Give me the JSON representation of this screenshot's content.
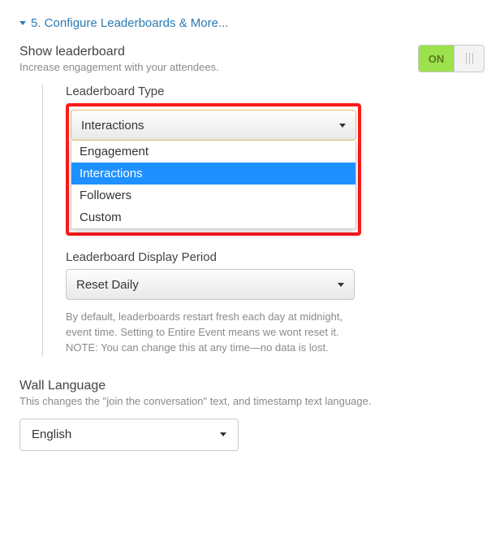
{
  "section": {
    "title": "5. Configure Leaderboards & More..."
  },
  "showLeaderboard": {
    "title": "Show leaderboard",
    "subtitle": "Increase engagement with your attendees.",
    "toggleOn": "ON"
  },
  "leaderboardType": {
    "label": "Leaderboard Type",
    "selected": "Interactions",
    "options": [
      "Engagement",
      "Interactions",
      "Followers",
      "Custom"
    ]
  },
  "displayPeriod": {
    "label": "Leaderboard Display Period",
    "selected": "Reset Daily",
    "help": "By default, leaderboards restart fresh each day at midnight, event time. Setting to Entire Event means we wont reset it. NOTE: You can change this at any time—no data is lost."
  },
  "wallLanguage": {
    "title": "Wall Language",
    "subtitle": "This changes the \"join the conversation\" text, and timestamp text language.",
    "selected": "English"
  }
}
